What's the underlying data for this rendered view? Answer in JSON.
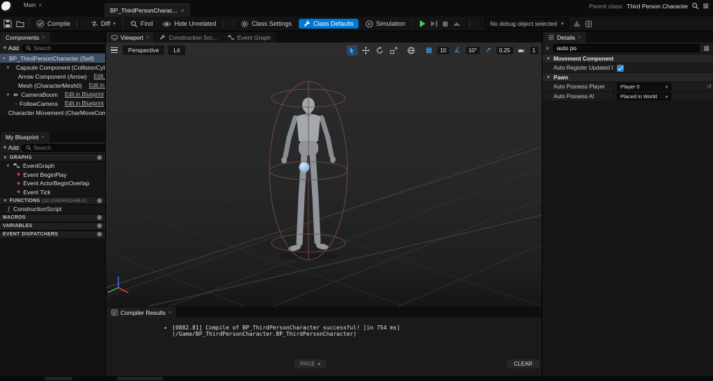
{
  "titlebar": {
    "main_tab": "Main",
    "doc_tab": "BP_ThirdPersonCharac...",
    "parent_class_label": "Parent class:",
    "parent_class_value": "Third Person Character"
  },
  "toolbar": {
    "compile": "Compile",
    "diff": "Diff",
    "find": "Find",
    "hide_unrelated": "Hide Unrelated",
    "class_settings": "Class Settings",
    "class_defaults": "Class Defaults",
    "simulation": "Simulation",
    "debug_select": "No debug object selected"
  },
  "components": {
    "title": "Components",
    "add_label": "Add",
    "search_placeholder": "Search",
    "rows": [
      {
        "label": "BP_ThirdPersonCharacter (Self)",
        "edit": ""
      },
      {
        "label": "Capsule Component (CollisionCylinder)",
        "edit": ""
      },
      {
        "label": "Arrow Component (Arrow)",
        "edit": "Edit in C++"
      },
      {
        "label": "Mesh (CharacterMesh0)",
        "edit": "Edit in C++"
      },
      {
        "label": "CameraBoom",
        "edit": "Edit in Blueprint"
      },
      {
        "label": "FollowCamera",
        "edit": "Edit in Blueprint"
      },
      {
        "label": "Character Movement (CharMoveComp)",
        "edit": ""
      }
    ]
  },
  "my_blueprint": {
    "title": "My Blueprint",
    "add_label": "Add",
    "search_placeholder": "Search",
    "graphs_header": "GRAPHS",
    "event_graph": "EventGraph",
    "events": [
      "Event BeginPlay",
      "Event ActorBeginOverlap",
      "Event Tick"
    ],
    "functions_header": "FUNCTIONS",
    "functions_note": "(32 OVERRIDABLE)",
    "construction_script": "ConstructionScript",
    "macros_header": "MACROS",
    "variables_header": "VARIABLES",
    "dispatchers_header": "EVENT DISPATCHERS"
  },
  "viewport": {
    "tab_viewport": "Viewport",
    "tab_construction": "Construction Scr...",
    "tab_event_graph": "Event Graph",
    "perspective": "Perspective",
    "lit": "Lit",
    "grid_snap": "10",
    "angle_snap": "10°",
    "scale_snap": "0.25",
    "camera_speed": "1"
  },
  "compiler": {
    "title": "Compiler Results",
    "log": "[0882.81] Compile of BP_ThirdPersonCharacter successful!  [in 754 ms] (/Game/BP_ThirdPersonCharacter.BP_ThirdPersonCharacter)",
    "page_button": "PAGE",
    "clear_button": "CLEAR"
  },
  "details": {
    "title": "Details",
    "search_value": "auto po",
    "movement_header": "Movement Component",
    "auto_register_label": "Auto Register Updated Compo...",
    "pawn_header": "Pawn",
    "auto_possess_player_label": "Auto Possess Player",
    "auto_possess_player_value": "Player 0",
    "auto_possess_ai_label": "Auto Possess AI",
    "auto_possess_ai_value": "Placed in World"
  },
  "icons": {
    "close": "×",
    "caret_down": "▾",
    "kebab": "⋮",
    "circle_plus": "⊕",
    "diamond": "◆",
    "fn": "ƒ",
    "bullet": "•",
    "grid": "▦",
    "angle": "∠",
    "arrow_ne": "↗",
    "reset": "↺"
  },
  "colors": {
    "accent_blue": "#0079d6",
    "play_green": "#58c15c",
    "selection": "#3f4f63",
    "capsule_wireframe": "#7d4a4a"
  }
}
